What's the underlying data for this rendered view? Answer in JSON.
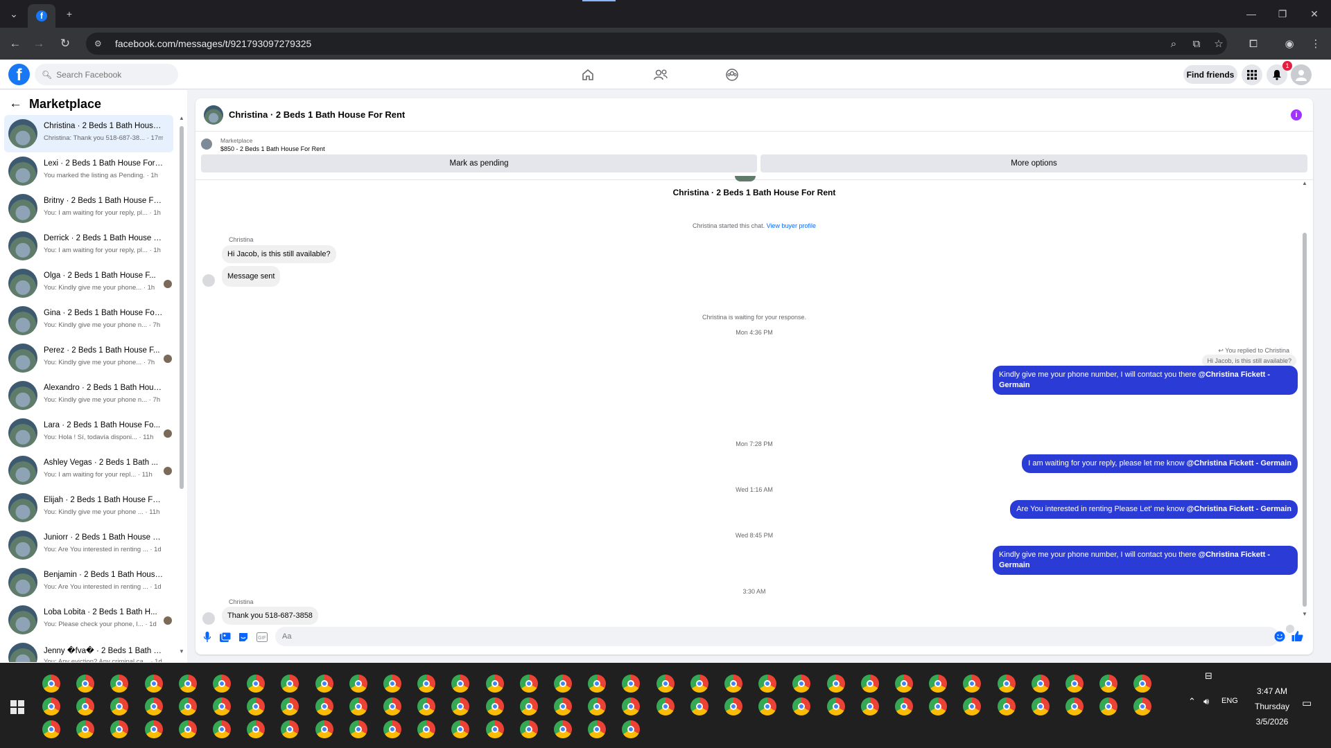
{
  "browser": {
    "url": "facebook.com/messages/t/921793097279325",
    "new_tab": "+",
    "win_min": "—",
    "win_max": "❐",
    "win_close": "✕"
  },
  "fb": {
    "logo": "f",
    "search_placeholder": "Search Facebook",
    "find_friends": "Find friends",
    "notifications_count": "1"
  },
  "sidebar": {
    "title": "Marketplace",
    "conversations": [
      {
        "name": "Christina · 2 Beds 1 Bath House ...",
        "preview": "Christina: Thank you 518-687-38... · 17m",
        "active": true
      },
      {
        "name": "Lexi · 2 Beds 1 Bath House For R...",
        "preview": "You marked the listing as Pending. · 1h"
      },
      {
        "name": "Britny · 2 Beds 1 Bath House Fo...",
        "preview": "You: I am waiting for your reply, pl... · 1h"
      },
      {
        "name": "Derrick · 2 Beds 1 Bath House F...",
        "preview": "You: I am waiting for your reply, pl... · 1h"
      },
      {
        "name": "Olga · 2 Beds 1 Bath House F...",
        "preview": "You: Kindly give me your phone... · 1h",
        "seen": true
      },
      {
        "name": "Gina · 2 Beds 1 Bath House For ...",
        "preview": "You: Kindly give me your phone n... · 7h"
      },
      {
        "name": "Perez · 2 Beds 1 Bath House F...",
        "preview": "You: Kindly give me your phone... · 7h",
        "seen": true
      },
      {
        "name": "Alexandro · 2 Beds 1 Bath Hous...",
        "preview": "You: Kindly give me your phone n... · 7h"
      },
      {
        "name": "Lara · 2 Beds 1 Bath House Fo...",
        "preview": "You: Hola ! Sí, todavía disponi... · 11h",
        "seen": true
      },
      {
        "name": "Ashley Vegas · 2 Beds 1 Bath ...",
        "preview": "You: I am waiting for your repl... · 11h",
        "seen": true
      },
      {
        "name": "Elijah · 2 Beds 1 Bath House For...",
        "preview": "You: Kindly give me your phone ... · 11h"
      },
      {
        "name": "Juniorr · 2 Beds 1 Bath House F...",
        "preview": "You: Are You interested in renting ... · 1d"
      },
      {
        "name": "Benjamin · 2 Beds 1 Bath House...",
        "preview": "You: Are You interested in renting ... · 1d"
      },
      {
        "name": "Loba Lobita · 2 Beds 1 Bath H...",
        "preview": "You: Please check your phone, I... · 1d",
        "seen": true
      },
      {
        "name": "Jenny �fva� · 2 Beds 1 Bath H...",
        "preview": "You: Any eviction? Any criminal ca... · 1d"
      }
    ]
  },
  "chat": {
    "title": "Christina · 2 Beds 1 Bath House For Rent",
    "info": "i",
    "marketplace_label": "Marketplace",
    "listing": "$850 - 2 Beds 1 Bath House For Rent",
    "mark_pending": "Mark as pending",
    "more_options": "More options",
    "thread_title": "Christina · 2 Beds 1 Bath House For Rent",
    "started": "Christina started this chat.",
    "view_buyer_profile": "View buyer profile",
    "sender_name": "Christina",
    "msg_hi": "Hi Jacob, is this still available?",
    "msg_sent": "Message sent",
    "waiting": "Christina is waiting for your response.",
    "ts1": "Mon 4:36 PM",
    "replied_to": "You replied to Christina",
    "quoted": "Hi Jacob, is this still available?",
    "out1_text": "Kindly give me your phone number, I will contact you there ",
    "out1_mention": "@Christina Fickett - Germain",
    "ts2": "Mon 7:28 PM",
    "out2_text": "I am waiting for your reply, please let me know ",
    "out2_mention": "@Christina Fickett - Germain",
    "ts3": "Wed 1:16 AM",
    "out3_text": "Are You  interested in renting Please Let' me know ",
    "out3_mention": "@Christina Fickett - Germain",
    "ts4": "Wed 8:45 PM",
    "out4_text": "Kindly give me your phone number, I will contact you there ",
    "out4_mention": "@Christina Fickett - Germain",
    "ts5": "3:30 AM",
    "sender_name2": "Christina",
    "msg_thanks": "Thank you 518-687-3858",
    "composer_placeholder": "Aa"
  },
  "taskbar": {
    "time": "3:47 AM",
    "day": "Thursday",
    "date": "3/5/2026",
    "lang": "ENG"
  },
  "colors": {
    "fb_blue": "#1877f2",
    "outgoing_bubble": "#2b3bd6",
    "active_conv": "#e7f0fd"
  }
}
